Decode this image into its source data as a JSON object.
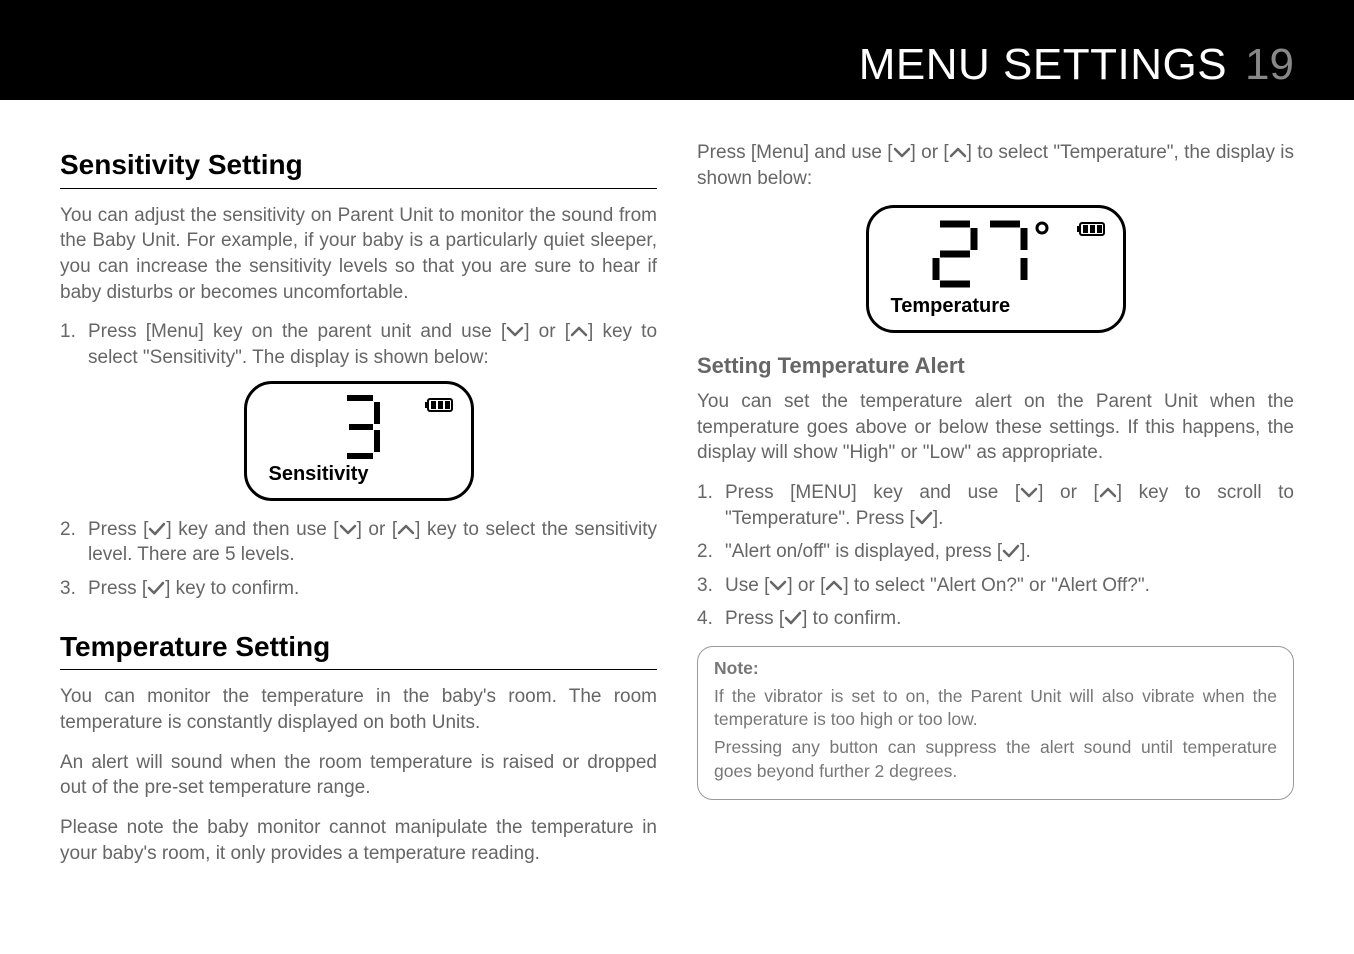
{
  "header": {
    "title": "MENU SETTINGS",
    "page": "19"
  },
  "left": {
    "h_sens": "Sensitivity Setting",
    "sens_intro": "You can adjust the sensitivity on Parent Unit to monitor the sound from the Baby Unit. For example, if your baby is a particularly quiet sleeper, you can increase the sensitivity levels so that you are sure to hear if baby disturbs or becomes uncomfortable.",
    "sens_step1_a": "Press [Menu] key on the parent unit and use [",
    "sens_step1_b": "] or [",
    "sens_step1_c": "] key to select \"Sensitivity\". The display is shown below:",
    "lcd1_value": "3",
    "lcd1_label": "Sensitivity",
    "sens_step2_a": "Press [",
    "sens_step2_b": "] key and then use [",
    "sens_step2_c": "] or [",
    "sens_step2_d": "] key to select the sensitivity level. There are 5 levels.",
    "sens_step3_a": "Press [",
    "sens_step3_b": "] key to confirm.",
    "h_temp": "Temperature Setting",
    "temp_p1": "You can monitor the temperature in the baby's room. The room temperature is constantly displayed on both Units.",
    "temp_p2": "An alert will sound when the room temperature is raised or dropped out of the pre-set temperature range.",
    "temp_p3": "Please note the baby monitor cannot manipulate the temperature in your baby's room, it only provides a temperature reading."
  },
  "right": {
    "intro_a": "Press [Menu] and use [",
    "intro_b": "] or [",
    "intro_c": "] to select \"Temperature\", the display is shown below:",
    "lcd2_value": "27",
    "lcd2_label": "Temperature",
    "h_alert": "Setting Temperature Alert",
    "alert_intro": "You can set the temperature alert on the Parent Unit when the temperature goes above or below these settings. If this happens, the display will show \"High\" or \"Low\" as appropriate.",
    "a1_a": "Press [MENU] key and use [",
    "a1_b": "] or [",
    "a1_c": "] key to scroll to \"Temperature\". Press [",
    "a1_d": "].",
    "a2_a": "\"Alert on/off\" is displayed, press [",
    "a2_b": "].",
    "a3_a": "Use [",
    "a3_b": "] or [",
    "a3_c": "] to select \"Alert On?\" or \"Alert Off?\".",
    "a4_a": "Press [",
    "a4_b": "] to confirm.",
    "note_title": "Note:",
    "note_p1": "If the vibrator is set to on, the Parent Unit will also vibrate when the temperature is too high or too low.",
    "note_p2": "Pressing any button can suppress the alert sound until temperature goes beyond further 2 degrees."
  }
}
